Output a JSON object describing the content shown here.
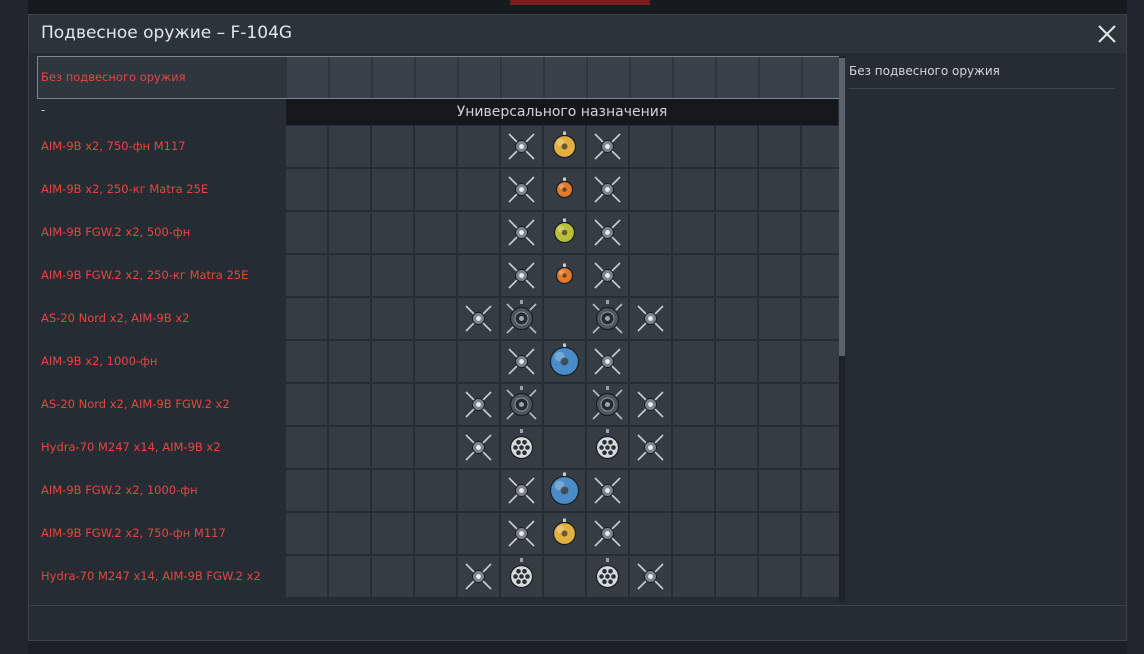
{
  "window": {
    "title": "Подвесное оружие – F-104G"
  },
  "no_weapons": {
    "label": "Без подвесного оружия"
  },
  "section": {
    "dash": "-",
    "title": "Универсального назначения"
  },
  "details": {
    "title": "Без подвесного оружия"
  },
  "colors": {
    "label_red": "#e8453f",
    "cell": "#353c44",
    "bomb_gold": "#e1b040",
    "bomb_orange": "#e37a2a",
    "bomb_olive": "#b8bf3a",
    "bomb_blue": "#4a8cc8"
  },
  "presets": [
    {
      "label": "AIM-9B x2,  750-фн M117",
      "slots": [
        "",
        "",
        "",
        "",
        "",
        "missile",
        "bomb-gold",
        "missile",
        "",
        "",
        "",
        "",
        ""
      ]
    },
    {
      "label": "AIM-9B x2,  250-кг Matra 25E",
      "slots": [
        "",
        "",
        "",
        "",
        "",
        "missile",
        "bomb-orange",
        "missile",
        "",
        "",
        "",
        "",
        ""
      ]
    },
    {
      "label": "AIM-9B FGW.2 x2,  500-фн",
      "slots": [
        "",
        "",
        "",
        "",
        "",
        "missile",
        "bomb-olive",
        "missile",
        "",
        "",
        "",
        "",
        ""
      ]
    },
    {
      "label": "AIM-9B FGW.2 x2,  250-кг Matra 25E",
      "slots": [
        "",
        "",
        "",
        "",
        "",
        "missile",
        "bomb-orange",
        "missile",
        "",
        "",
        "",
        "",
        ""
      ]
    },
    {
      "label": "AS-20 Nord x2,  AIM-9B x2",
      "slots": [
        "",
        "",
        "",
        "",
        "missile",
        "guided-missile",
        "",
        "guided-missile",
        "missile",
        "",
        "",
        "",
        ""
      ]
    },
    {
      "label": "AIM-9B x2,  1000-фн",
      "slots": [
        "",
        "",
        "",
        "",
        "",
        "missile",
        "bomb-blue",
        "missile",
        "",
        "",
        "",
        "",
        ""
      ]
    },
    {
      "label": "AS-20 Nord x2,  AIM-9B FGW.2 x2",
      "slots": [
        "",
        "",
        "",
        "",
        "missile",
        "guided-missile",
        "",
        "guided-missile",
        "missile",
        "",
        "",
        "",
        ""
      ]
    },
    {
      "label": "Hydra-70 M247 x14,  AIM-9B x2",
      "slots": [
        "",
        "",
        "",
        "",
        "missile",
        "rocket-pod",
        "",
        "rocket-pod",
        "missile",
        "",
        "",
        "",
        ""
      ]
    },
    {
      "label": "AIM-9B FGW.2 x2,  1000-фн",
      "slots": [
        "",
        "",
        "",
        "",
        "",
        "missile",
        "bomb-blue",
        "missile",
        "",
        "",
        "",
        "",
        ""
      ]
    },
    {
      "label": "AIM-9B FGW.2 x2,  750-фн M117",
      "slots": [
        "",
        "",
        "",
        "",
        "",
        "missile",
        "bomb-gold",
        "missile",
        "",
        "",
        "",
        "",
        ""
      ]
    },
    {
      "label": "Hydra-70 M247 x14,  AIM-9B FGW.2 x2",
      "slots": [
        "",
        "",
        "",
        "",
        "missile",
        "rocket-pod",
        "",
        "rocket-pod",
        "missile",
        "",
        "",
        "",
        ""
      ]
    }
  ]
}
